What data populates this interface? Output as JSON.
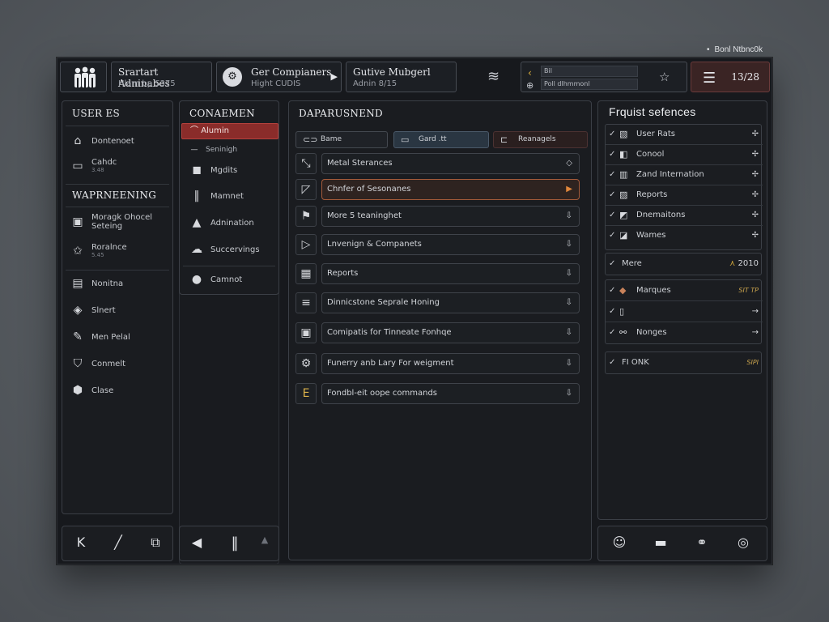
{
  "corner_label": "Bonl Ntbnc0k",
  "topbar": {
    "box2": {
      "title": "Srartart Adninabes",
      "sub": "Hlam bp S375"
    },
    "box3": {
      "title": "Ger Compianers",
      "sub": "Hight CUDIS"
    },
    "box4": {
      "title": "Gutive Mubgerl",
      "sub": "Adnin 8/15"
    },
    "box5": {
      "row1": "Bil",
      "row2": "Poll dlhmmonl"
    },
    "counter": "13/28"
  },
  "panel_left": {
    "header1": "USER ES",
    "items1": [
      {
        "icon": "house-icon",
        "label": "Dontenoet"
      },
      {
        "icon": "clipboard-icon",
        "label": "Cahdc",
        "sub": "3.48"
      }
    ],
    "header2": "WAPRNEENING",
    "items2": [
      {
        "icon": "monitor-icon",
        "label": "Moragk Ohocel",
        "label2": "Seteing"
      },
      {
        "icon": "star-icon",
        "label": "Roralnce",
        "sub": "5.45"
      }
    ],
    "items3": [
      {
        "icon": "chip-icon",
        "label": "Nonitna"
      },
      {
        "icon": "cube-icon",
        "label": "Slnert"
      },
      {
        "icon": "pencil-icon",
        "label": "Men Pelal"
      },
      {
        "icon": "shield-icon",
        "label": "Conmelt"
      },
      {
        "icon": "hexagon-icon",
        "label": "Clase"
      }
    ]
  },
  "panel_mid": {
    "header": "CONAEMEN",
    "active": "Alumin",
    "sub_active": "Seninigh",
    "items": [
      {
        "icon": "bag-icon",
        "label": "Mgdits"
      },
      {
        "icon": "pause-icon",
        "label": "Mamnet"
      },
      {
        "icon": "bottle-icon",
        "label": "Adnination"
      },
      {
        "icon": "cloud-icon",
        "label": "Succervings"
      },
      {
        "icon": "info-icon",
        "label": "Camnot"
      }
    ]
  },
  "panel_main": {
    "header": "DAPARUSNEND",
    "chips": [
      "Bame",
      "Gard .tt",
      "Reanagels"
    ],
    "rows": [
      "Metal Sterances",
      "Chnfer of Sesonanes",
      "More 5 teaninghet",
      "Lnvenign & Companets",
      "Reports",
      "Dinnicstone Seprale Honing",
      "Comipatis for Tinneate Fonhqe",
      "Funerry anb Lary For weigment",
      "Fondbl-eit oope commands"
    ]
  },
  "panel_right": {
    "header": "Frquist sefences",
    "group1": [
      "User Rats",
      "Conool",
      "Zand Internation",
      "Reports",
      "Dnemaitons",
      "Wames"
    ],
    "more_label": "Mere",
    "more_value": "2010",
    "group2": [
      {
        "label": "Marques",
        "act": "SIT TP"
      },
      {
        "label": "",
        "act": "→"
      },
      {
        "label": "Nonges",
        "act": "→"
      }
    ],
    "group3": {
      "label": "FI ONK",
      "act": "SIPI"
    }
  },
  "colors": {
    "accent_red": "#8a2c2a",
    "highlight_orange": "#e1873b",
    "amber": "#c9a34d"
  }
}
